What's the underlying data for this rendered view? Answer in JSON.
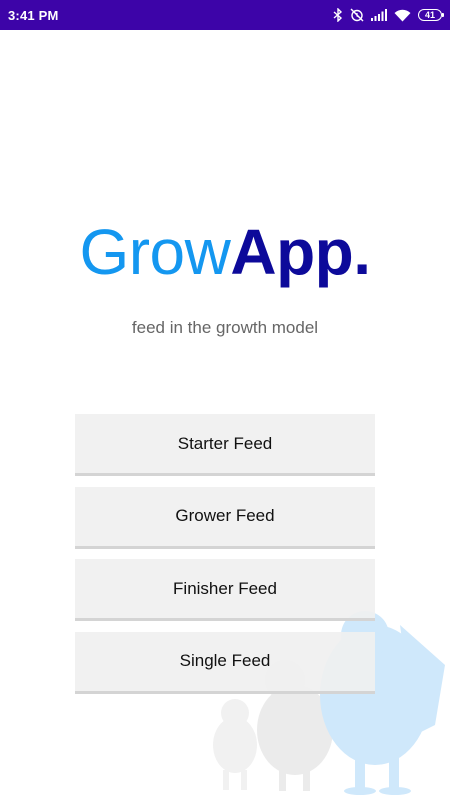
{
  "status_bar": {
    "time": "3:41 PM",
    "battery": "41",
    "icons": [
      "bluetooth-icon",
      "alarm-off-icon",
      "signal-icon",
      "wifi-icon",
      "battery-icon"
    ],
    "background": "#3d04a8"
  },
  "logo": {
    "part_grow": "Grow",
    "part_app": "App",
    "part_dot": ".",
    "color_grow": "#1497f0",
    "color_app": "#0d0a9a"
  },
  "tagline": "feed in the growth model",
  "buttons": [
    {
      "label": "Starter Feed"
    },
    {
      "label": "Grower Feed"
    },
    {
      "label": "Finisher Feed"
    },
    {
      "label": "Single Feed"
    }
  ],
  "decoration": {
    "icon": "chicken-growth-illustration"
  }
}
